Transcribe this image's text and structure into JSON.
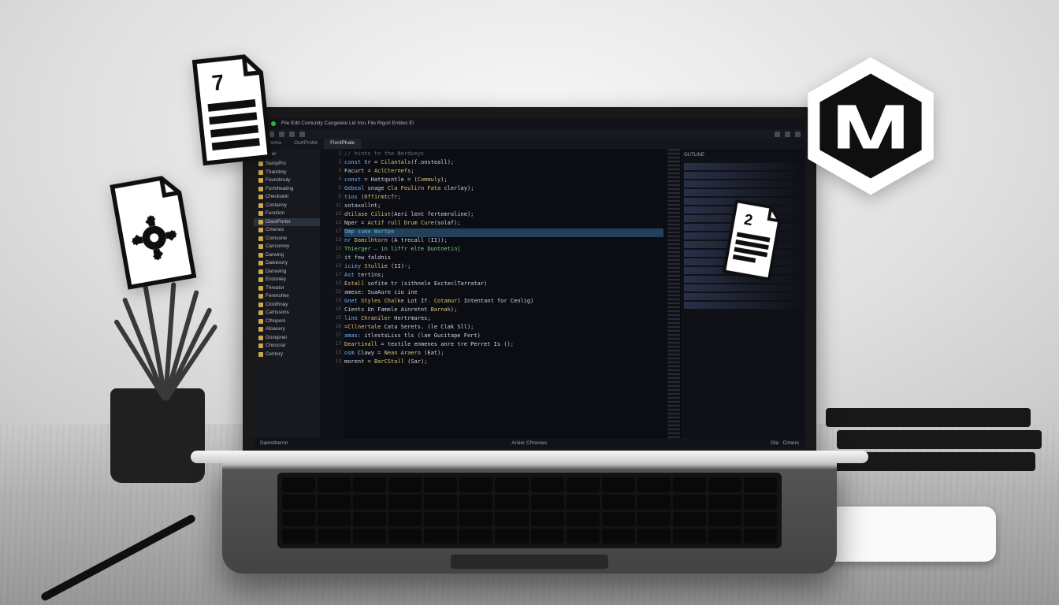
{
  "menus": [
    "File",
    "Edit",
    "Comunity",
    "Cangelete",
    "Lid",
    "Inru",
    "File",
    "Rigorl",
    "Entites",
    "El"
  ],
  "tabs": [
    {
      "label": "Ourterms",
      "active": false
    },
    {
      "label": "OurtProfet",
      "active": false
    },
    {
      "label": "FlentPhale",
      "active": true
    }
  ],
  "sidebar": {
    "header": "Explorer",
    "items": [
      "SantyPro",
      "Thandrey",
      "Foundrouly",
      "Formheating",
      "Checksein",
      "Contanny",
      "Function",
      "OlastPorter",
      "Cmenes",
      "Comsone",
      "Cancomey",
      "Darwing",
      "Dawesory",
      "Darswing",
      "Enzoniey",
      "Threator",
      "Ferenshke",
      "Cloothnay",
      "Camssons",
      "Cthoponi",
      "Afoacery",
      "Gosepnei",
      "Choscrar",
      "Centory"
    ],
    "selected_index": 7
  },
  "code": {
    "lines": [
      {
        "n": "1",
        "t": "<span class='cm'>// hints to the Nerdveys</span>"
      },
      {
        "n": "2",
        "t": "<span class='kw'>const</span> <span class='id'>tr</span> = <span class='fn'>Cilantals</span>(<span class='id'>f.onsteall</span>);"
      },
      {
        "n": "3",
        "t": "  <span class='id'>Facurt</span> = <span class='fn'>AclCternefs</span>;"
      },
      {
        "n": "4",
        "t": "  <span class='kw'>const</span> = <span class='id'>Hattqsntle</span> = (<span class='fn'>Commuly</span>);"
      },
      {
        "n": "5",
        "t": "  <span class='kw'>Gebeal</span> <span class='id'>snage</span>  <span class='fn'>Cla Feulirn Fata</span> <span class='id'>clerlay</span>);"
      },
      {
        "n": "8",
        "t": "<span class='kw'>tios</span> (<span class='fn'>Offirmtcfr</span>;"
      },
      {
        "n": "11",
        "t": "  <span class='id'>sotaxollnt</span>;"
      },
      {
        "n": "13",
        "t": "    <span class='fn'>dtilase</span>   <span class='fn'>Cilist</span>(<span class='id'>Aeri lent fertemroline</span>);"
      },
      {
        "n": "13",
        "t": "    <span class='id'>Nper</span> = <span class='fn'>Actif rull Drum Cure</span>(<span class='id'>solaf</span>);",
        "hl": false
      },
      {
        "n": "17",
        "t": "  <span class='tp'>Omp sume  Wartpe</span>",
        "hl": true
      },
      {
        "n": "13",
        "t": "<span class='kw'>nr</span> <span class='fn'>Damclhtorn</span> (<span class='id'>A  trecall</span>  (<span class='id'>II</span>));"
      },
      {
        "n": "13",
        "t": "   <span class='str'>Thierger — in liffr  elte Duntnetin|</span>"
      },
      {
        "n": "11",
        "t": "  <span class='id'>it few  faldnis</span>"
      },
      {
        "n": "13",
        "t": " <span class='kw'>iciey</span> <span class='fn'>Stullie</span> (<span class='id'>II</span>)-;"
      },
      {
        "n": "17",
        "t": "<span class='kw'>Ast</span>  <span class='id'>tertins</span>;"
      },
      {
        "n": "13",
        "t": "<span class='fn'>Estall</span> <span class='id'>sofite tr</span> (<span class='id'>sithnele  ExcteclTarratar</span>)"
      },
      {
        "n": "23",
        "t": "<span class='id'>amese</span>: <span class='id'>SuaAure</span> <span class='id'>cio ine</span>"
      },
      {
        "n": "15",
        "t": "<span class='kw'>Gnet</span> <span class='fn'>Styles Chalke</span> <span class='id'>Lot If.</span> <span class='fn'>Cotamurl</span> <span class='id'>Intentant for Cenlig</span>)"
      },
      {
        "n": "15",
        "t": "<span class='id'>Cients Un Famele Ainretnt</span> <span class='fn'>Barnak</span>);"
      },
      {
        "n": "15",
        "t": "<span class='kw'>line</span> <span class='fn'>Chraniler</span> <span class='id'>Hertrmares</span>;"
      },
      {
        "n": "16",
        "t": "=<span class='fn'>Cllnertale</span> <span class='id'>Cata Serets</span>.  (<span class='id'>le Clak   Sll</span>);"
      },
      {
        "n": "27",
        "t": "<span class='kw'>amas</span>: <span class='id'>itlestsLiss tls</span> (<span class='id'>lae Gucitape Fert</span>)"
      },
      {
        "n": "17",
        "t": "<span class='fn'>Deartinall</span> = <span class='id'>textile enmenes anre tre Perret Is</span> ();"
      },
      {
        "n": "13",
        "t": "<span class='kw'>osm</span> <span class='id'>Clawy</span> = <span class='fn'>Nean Araero</span> <span class='id'>(Eat)</span>;"
      },
      {
        "n": "13",
        "t": "<span class='id'>morent</span>  = <span class='fn'>BarCStall</span> <span class='id'>(Sar)</span>;"
      }
    ]
  },
  "status": {
    "left": "Damsthernn",
    "center": "Arsier   Cfmones",
    "right_a": "Gla",
    "right_b": "Cimers"
  },
  "right_panel_title": "OUTLINE",
  "floating": {
    "doc_a_label": "7",
    "doc_b_label": "",
    "doc_c_label": "2"
  }
}
